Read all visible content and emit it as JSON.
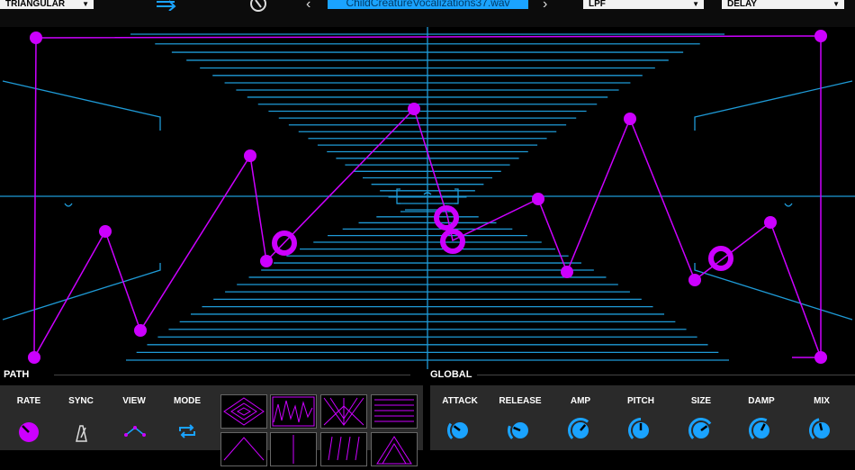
{
  "topbar": {
    "path_shape_select": "TRIANGULAR",
    "filename": "ChildCreatureVocalizations37.wav",
    "filter_select": "LPF",
    "effect_select": "DELAY"
  },
  "sections": {
    "path_label": "PATH",
    "global_label": "GLOBAL"
  },
  "path_controls": [
    {
      "label": "RATE"
    },
    {
      "label": "SYNC"
    },
    {
      "label": "VIEW"
    },
    {
      "label": "MODE"
    }
  ],
  "global_controls": [
    {
      "label": "ATTACK",
      "value": 0.3
    },
    {
      "label": "RELEASE",
      "value": 0.25
    },
    {
      "label": "AMP",
      "value": 0.65
    },
    {
      "label": "PITCH",
      "value": 0.5
    },
    {
      "label": "SIZE",
      "value": 0.7
    },
    {
      "label": "DAMP",
      "value": 0.6
    },
    {
      "label": "MIX",
      "value": 0.45
    }
  ],
  "colors": {
    "accent_blue": "#1aa3ff",
    "path_purple": "#cc00ff",
    "grid_blue": "#1e9ad6",
    "panel_bg": "#2a2a2a"
  },
  "icons": {
    "rate": "knob-icon",
    "sync": "metronome-icon",
    "view": "triangle-path-icon",
    "mode": "loop-icon"
  }
}
